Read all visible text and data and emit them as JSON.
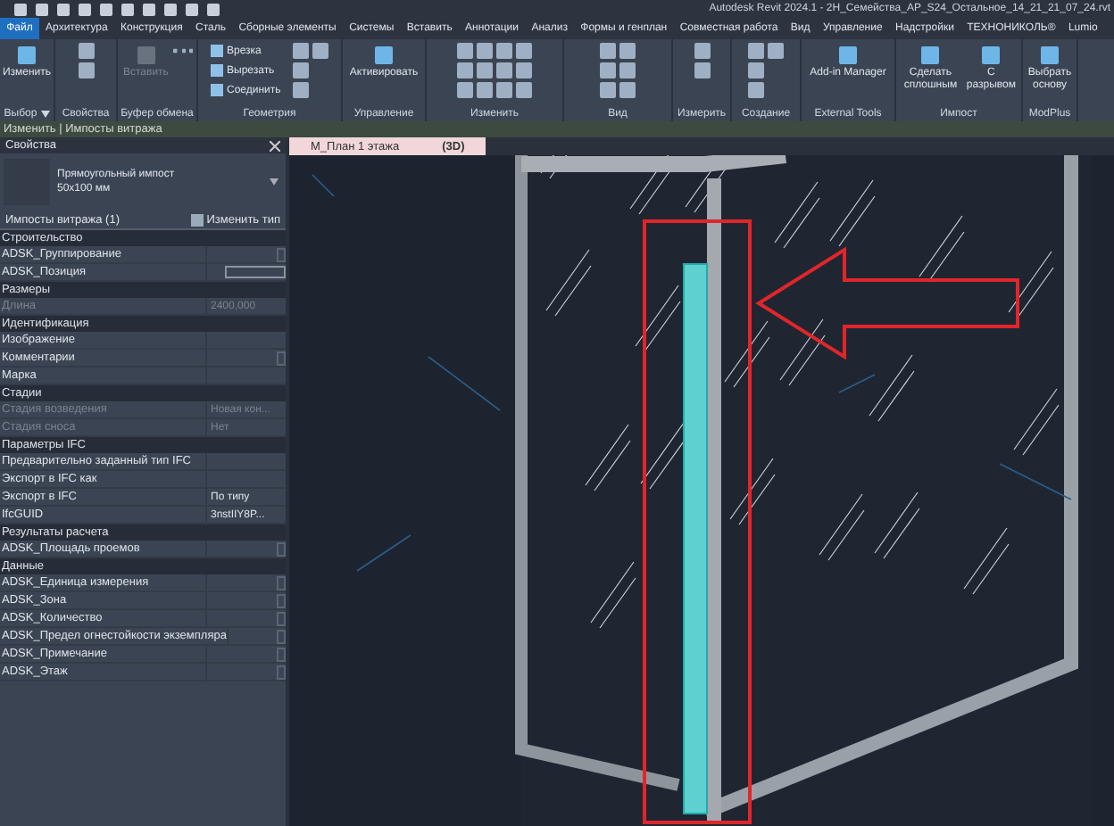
{
  "window": {
    "title": "Autodesk Revit 2024.1 - 2Н_Семейства_АР_S24_Остальное_14_21_21_07_24.rvt"
  },
  "menu_tabs": [
    {
      "label": "Файл",
      "selected": true
    },
    {
      "label": "Архитектура",
      "selected": false
    },
    {
      "label": "Конструкция",
      "selected": false
    },
    {
      "label": "Сталь",
      "selected": false
    },
    {
      "label": "Сборные элементы",
      "selected": false
    },
    {
      "label": "Системы",
      "selected": false
    },
    {
      "label": "Вставить",
      "selected": false
    },
    {
      "label": "Аннотации",
      "selected": false
    },
    {
      "label": "Анализ",
      "selected": false
    },
    {
      "label": "Формы и генплан",
      "selected": false
    },
    {
      "label": "Совместная работа",
      "selected": false
    },
    {
      "label": "Вид",
      "selected": false
    },
    {
      "label": "Управление",
      "selected": false
    },
    {
      "label": "Надстройки",
      "selected": false
    },
    {
      "label": "ТЕХНОНИКОЛЬ®",
      "selected": false
    },
    {
      "label": "Lumio",
      "selected": false
    }
  ],
  "ribbon_panels": [
    {
      "title": "Выбор",
      "dropdown": true,
      "buttons": [
        {
          "kind": "large",
          "label": "Изменить",
          "disabled": false
        }
      ]
    },
    {
      "title": "Свойства",
      "dropdown": false,
      "buttons": [
        {
          "kind": "icon"
        },
        {
          "kind": "icon"
        }
      ]
    },
    {
      "title": "Буфер обмена",
      "dropdown": false,
      "buttons": [
        {
          "kind": "large",
          "label": "Вставить",
          "disabled": true
        },
        {
          "kind": "icon"
        },
        {
          "kind": "icon"
        },
        {
          "kind": "icon"
        }
      ]
    },
    {
      "title": "Геометрия",
      "dropdown": false,
      "buttons": [
        {
          "kind": "small",
          "label": "Врезка",
          "disabled": false
        },
        {
          "kind": "small",
          "label": "Вырезать",
          "disabled": false
        },
        {
          "kind": "small",
          "label": "Соединить",
          "disabled": false
        },
        {
          "kind": "icon"
        },
        {
          "kind": "icon"
        },
        {
          "kind": "icon"
        },
        {
          "kind": "icon"
        }
      ]
    },
    {
      "title": "Управление",
      "dropdown": false,
      "buttons": [
        {
          "kind": "large",
          "label": "Активировать",
          "disabled": false
        }
      ]
    },
    {
      "title": "Изменить",
      "dropdown": false,
      "buttons": [
        {
          "kind": "icon"
        },
        {
          "kind": "icon"
        },
        {
          "kind": "icon"
        },
        {
          "kind": "icon"
        },
        {
          "kind": "icon"
        },
        {
          "kind": "icon"
        },
        {
          "kind": "icon"
        },
        {
          "kind": "icon"
        },
        {
          "kind": "icon"
        },
        {
          "kind": "icon"
        },
        {
          "kind": "icon"
        },
        {
          "kind": "icon"
        }
      ]
    },
    {
      "title": "Вид",
      "dropdown": false,
      "buttons": [
        {
          "kind": "icon"
        },
        {
          "kind": "icon"
        },
        {
          "kind": "icon"
        },
        {
          "kind": "icon"
        },
        {
          "kind": "icon"
        },
        {
          "kind": "icon"
        }
      ]
    },
    {
      "title": "Измерить",
      "dropdown": false,
      "buttons": [
        {
          "kind": "icon"
        },
        {
          "kind": "icon"
        }
      ]
    },
    {
      "title": "Создание",
      "dropdown": false,
      "buttons": [
        {
          "kind": "icon"
        },
        {
          "kind": "icon"
        },
        {
          "kind": "icon"
        },
        {
          "kind": "icon"
        }
      ]
    },
    {
      "title": "External Tools",
      "dropdown": false,
      "buttons": [
        {
          "kind": "large",
          "label": "Add-in Manager",
          "disabled": false
        }
      ]
    },
    {
      "title": "Импост",
      "dropdown": false,
      "buttons": [
        {
          "kind": "large",
          "label": "Сделать сплошным",
          "disabled": false
        },
        {
          "kind": "large",
          "label": "С разрывом",
          "disabled": false
        }
      ]
    },
    {
      "title": "ModPlus",
      "dropdown": false,
      "buttons": [
        {
          "kind": "large",
          "label": "Выбрать основу",
          "disabled": false
        }
      ]
    }
  ],
  "context_bar": "Изменить | Импосты витража",
  "properties": {
    "title": "Свойства",
    "type_name": "Прямоугольный импост",
    "type_size": "50x100 мм",
    "filter": "Импосты витража (1)",
    "edit_type": "Изменить тип",
    "groups": [
      {
        "title": "Строительство",
        "rows": [
          {
            "label": "ADSK_Группирование",
            "kind": "check",
            "disabled": false
          },
          {
            "label": "ADSK_Позиция",
            "kind": "field",
            "disabled": false
          }
        ]
      },
      {
        "title": "Размеры",
        "rows": [
          {
            "label": "Длина",
            "value": "2400,000",
            "kind": "text",
            "disabled": true
          }
        ]
      },
      {
        "title": "Идентификация",
        "rows": [
          {
            "label": "Изображение",
            "kind": "text",
            "disabled": false
          },
          {
            "label": "Комментарии",
            "kind": "check",
            "disabled": false
          },
          {
            "label": "Марка",
            "kind": "text",
            "disabled": false
          }
        ]
      },
      {
        "title": "Стадии",
        "rows": [
          {
            "label": "Стадия возведения",
            "value": "Новая кон...",
            "kind": "text",
            "disabled": true
          },
          {
            "label": "Стадия сноса",
            "value": "Нет",
            "kind": "text",
            "disabled": true
          }
        ]
      },
      {
        "title": "Параметры IFC",
        "rows": [
          {
            "label": "Предварительно заданный тип IFC",
            "kind": "text",
            "disabled": false
          },
          {
            "label": "Экспорт в IFC как",
            "kind": "text",
            "disabled": false
          },
          {
            "label": "Экспорт в IFC",
            "value": "По типу",
            "kind": "text",
            "disabled": false
          },
          {
            "label": "IfcGUID",
            "value": "3nstIIY8P...",
            "kind": "text",
            "disabled": false
          }
        ]
      },
      {
        "title": "Результаты расчета",
        "rows": [
          {
            "label": "ADSK_Площадь проемов",
            "kind": "check",
            "disabled": false
          }
        ]
      },
      {
        "title": "Данные",
        "rows": [
          {
            "label": "ADSK_Единица измерения",
            "kind": "check",
            "disabled": false
          },
          {
            "label": "ADSK_Зона",
            "kind": "check",
            "disabled": false
          },
          {
            "label": "ADSK_Количество",
            "kind": "check",
            "disabled": false
          },
          {
            "label": "ADSK_Предел огнестойкости экземпляра",
            "kind": "check",
            "disabled": false
          },
          {
            "label": "ADSK_Примечание",
            "kind": "check",
            "disabled": false
          },
          {
            "label": "ADSK_Этаж",
            "kind": "check",
            "disabled": false
          }
        ]
      }
    ]
  },
  "view_tabs": [
    {
      "label": "М_План 1 этажа",
      "selected": false
    },
    {
      "label": "(3D)",
      "selected": true
    }
  ]
}
